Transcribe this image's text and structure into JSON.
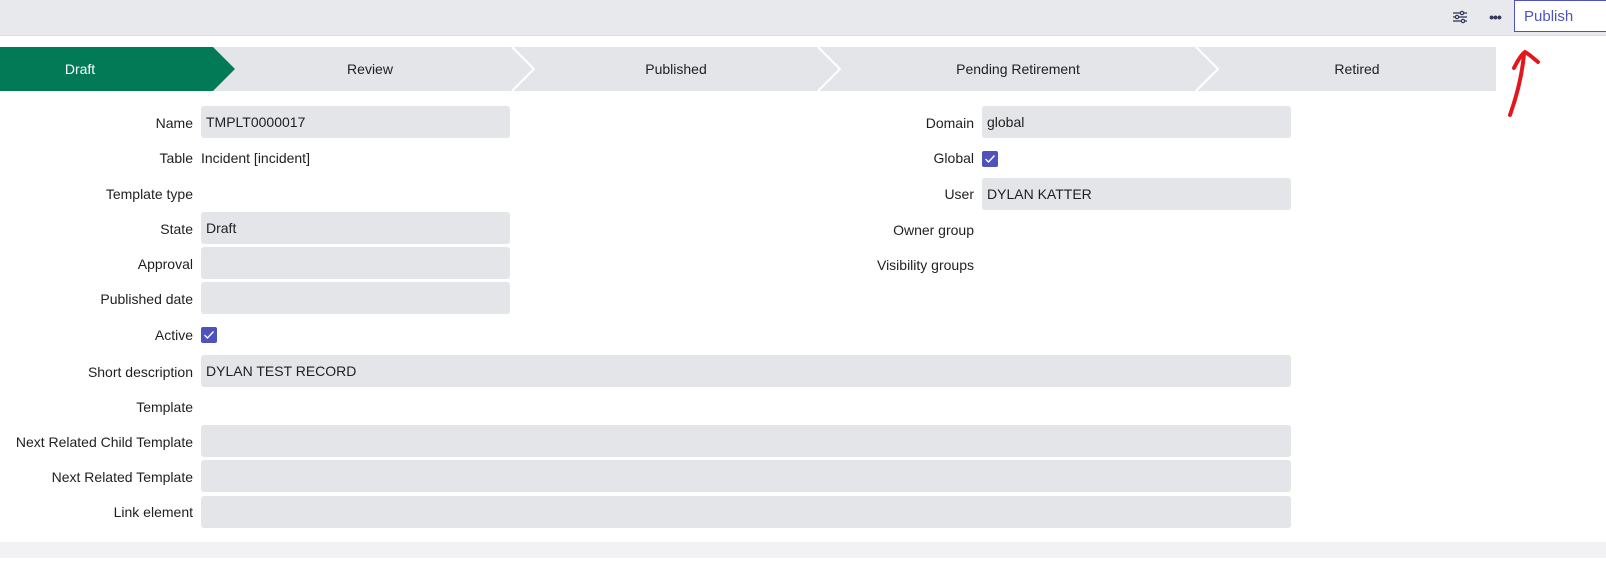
{
  "header": {
    "settings_icon": "sliders-icon",
    "more_icon": "ellipsis-icon",
    "publish_label": "Publish"
  },
  "stages": [
    {
      "label": "Draft",
      "active": true
    },
    {
      "label": "Review"
    },
    {
      "label": "Published"
    },
    {
      "label": "Pending Retirement"
    },
    {
      "label": "Retired"
    }
  ],
  "colors": {
    "active_stage": "#027a55",
    "accent": "#4f52bd",
    "field_bg": "#e4e5e9",
    "annotation": "#e3161b"
  },
  "left": {
    "name": {
      "label": "Name",
      "value": "TMPLT0000017"
    },
    "table": {
      "label": "Table",
      "value": "Incident [incident]"
    },
    "template_type": {
      "label": "Template type"
    },
    "state": {
      "label": "State",
      "value": "Draft"
    },
    "approval": {
      "label": "Approval",
      "value": ""
    },
    "published_date": {
      "label": "Published date",
      "value": ""
    },
    "active": {
      "label": "Active",
      "checked": true
    }
  },
  "right": {
    "domain": {
      "label": "Domain",
      "value": "global"
    },
    "global": {
      "label": "Global",
      "checked": true
    },
    "user": {
      "label": "User",
      "value": "DYLAN KATTER"
    },
    "owner_group": {
      "label": "Owner group"
    },
    "visibility_groups": {
      "label": "Visibility groups"
    }
  },
  "wide": {
    "short_description": {
      "label": "Short description",
      "value": "DYLAN TEST RECORD"
    },
    "template": {
      "label": "Template"
    },
    "next_related_child": {
      "label": "Next Related Child Template",
      "value": ""
    },
    "next_related": {
      "label": "Next Related Template",
      "value": ""
    },
    "link_element": {
      "label": "Link element",
      "value": ""
    }
  }
}
